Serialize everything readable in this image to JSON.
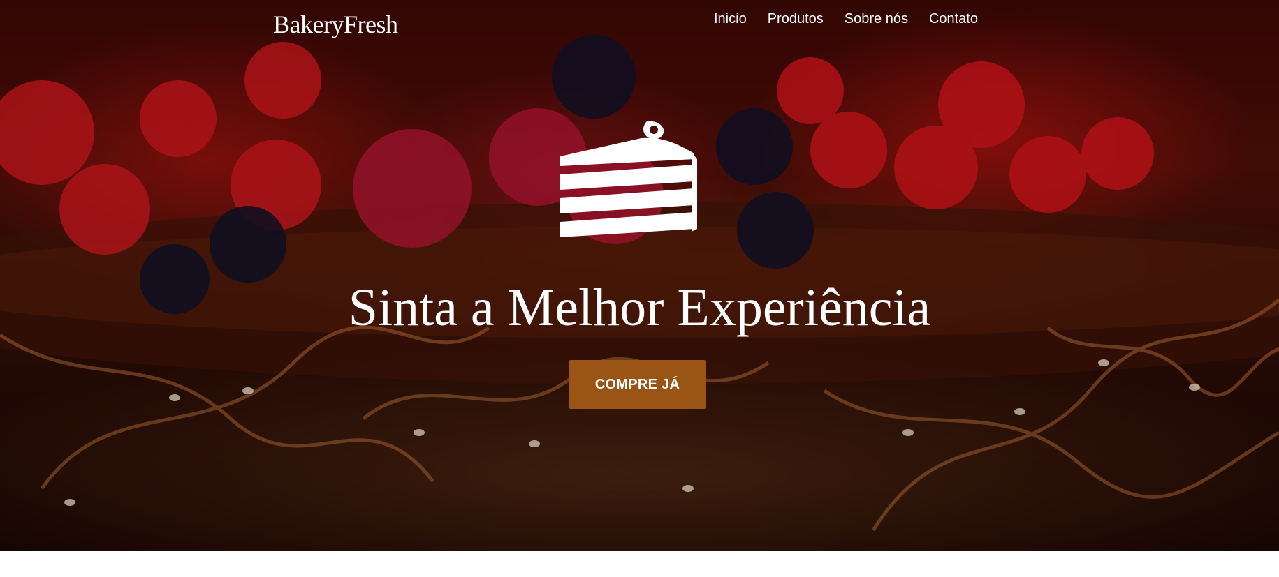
{
  "header": {
    "logo": "BakeryFresh",
    "nav": [
      {
        "label": "Inicio"
      },
      {
        "label": "Produtos"
      },
      {
        "label": "Sobre nós"
      },
      {
        "label": "Contato"
      }
    ]
  },
  "hero": {
    "icon": "cake-slice-icon",
    "title": "Sinta a Melhor Experiência",
    "cta_label": "COMPRE JÁ",
    "background": "chocolate-cake-with-berries-photo"
  },
  "colors": {
    "cta_background": "#9a5516",
    "text": "#ffffff",
    "page_background": "#ffffff"
  }
}
